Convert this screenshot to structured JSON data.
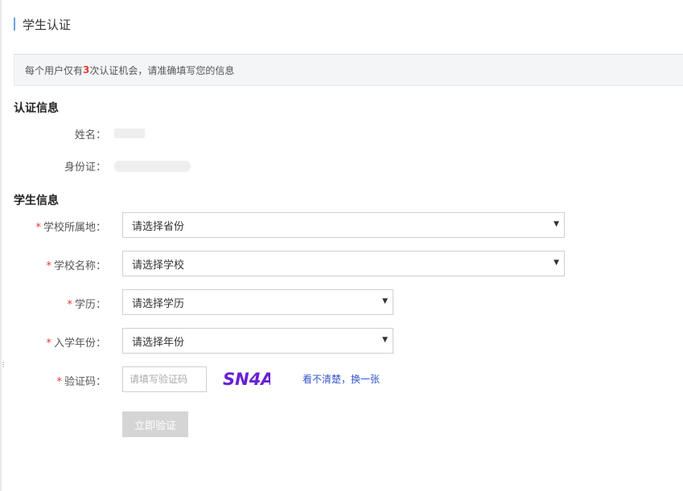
{
  "page": {
    "title": "学生认证"
  },
  "notice": {
    "prefix": "每个用户仅有",
    "count": "3",
    "suffix": "次认证机会，请准确填写您的信息"
  },
  "auth_section": {
    "title": "认证信息",
    "name_label": "姓名：",
    "id_label": "身份证："
  },
  "student_section": {
    "title": "学生信息",
    "required_mark": "*",
    "fields": {
      "province": {
        "label": "学校所属地：",
        "value": "请选择省份"
      },
      "school": {
        "label": "学校名称：",
        "value": "请选择学校"
      },
      "education": {
        "label": "学历：",
        "value": "请选择学历"
      },
      "year": {
        "label": "入学年份：",
        "value": "请选择年份"
      },
      "captcha": {
        "label": "验证码：",
        "placeholder": "请填写验证码",
        "image_text": "SN4A"
      }
    },
    "refresh_link": "看不清楚，换一张",
    "submit_label": "立即验证"
  },
  "icons": {
    "dropdown": "chevron-down-icon",
    "side_menu": "more-vertical-icon"
  },
  "colors": {
    "accent_bar": "#6ca0dc",
    "required": "#e53935",
    "link": "#3355cc",
    "captcha": "#6a1fd6",
    "button_disabled": "#d5d5d5"
  }
}
